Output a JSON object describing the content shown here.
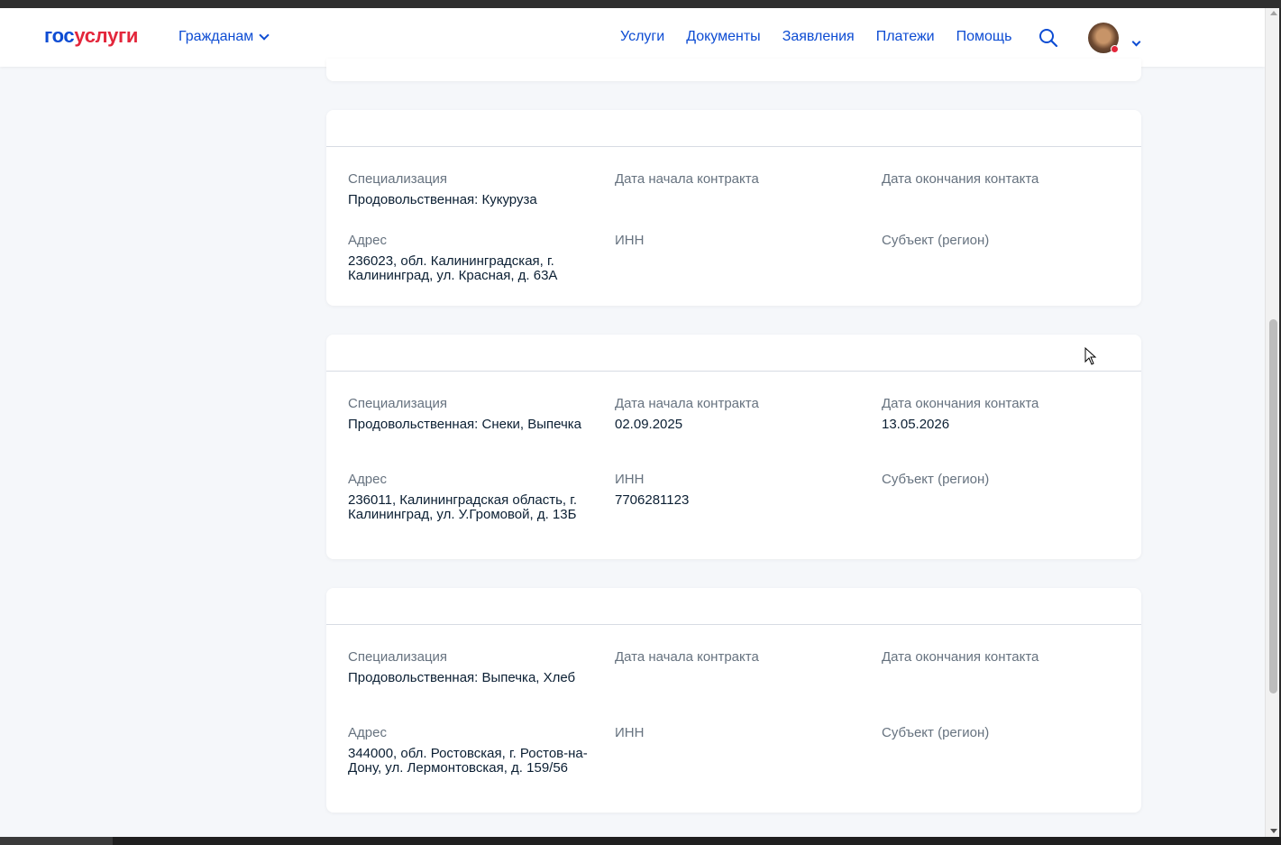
{
  "header": {
    "logo_part1": "гос",
    "logo_part2": "услуги",
    "role_label": "Гражданам",
    "nav": [
      "Услуги",
      "Документы",
      "Заявления",
      "Платежи",
      "Помощь"
    ],
    "search_icon": "search-icon",
    "avatar_icon": "user-avatar"
  },
  "cards": [
    {
      "row1": [
        {
          "label": "Специализация",
          "value": "Продовольственная: Кукуруза"
        },
        {
          "label": "Дата начала контракта",
          "value": ""
        },
        {
          "label": "Дата окончания контакта",
          "value": ""
        }
      ],
      "row2": [
        {
          "label": "Адрес",
          "value": "236023, обл. Калининградская, г. Калининград, ул. Красная, д. 63А"
        },
        {
          "label": "ИНН",
          "value": ""
        },
        {
          "label": "Субъект (регион)",
          "value": ""
        }
      ]
    },
    {
      "row1": [
        {
          "label": "Специализация",
          "value": "Продовольственная: Снеки, Выпечка"
        },
        {
          "label": "Дата начала контракта",
          "value": "02.09.2025"
        },
        {
          "label": "Дата окончания контакта",
          "value": "13.05.2026"
        }
      ],
      "row2": [
        {
          "label": "Адрес",
          "value": "236011, Калининградская область, г. Калининград, ул. У.Громовой, д. 13Б"
        },
        {
          "label": "ИНН",
          "value": "7706281123"
        },
        {
          "label": "Субъект (регион)",
          "value": ""
        }
      ]
    },
    {
      "row1": [
        {
          "label": "Специализация",
          "value": "Продовольственная: Выпечка, Хлеб"
        },
        {
          "label": "Дата начала контракта",
          "value": ""
        },
        {
          "label": "Дата окончания контакта",
          "value": ""
        }
      ],
      "row2": [
        {
          "label": "Адрес",
          "value": "344000, обл. Ростовская, г. Ростов-на-Дону, ул. Лермонтовская, д. 159/56"
        },
        {
          "label": "ИНН",
          "value": ""
        },
        {
          "label": "Субъект (регион)",
          "value": ""
        }
      ]
    }
  ],
  "colors": {
    "brand_blue": "#0d4cd3",
    "brand_red": "#e3263b",
    "label_gray": "#66727f",
    "text_dark": "#0b1f33",
    "page_bg": "#f5f7fa"
  }
}
